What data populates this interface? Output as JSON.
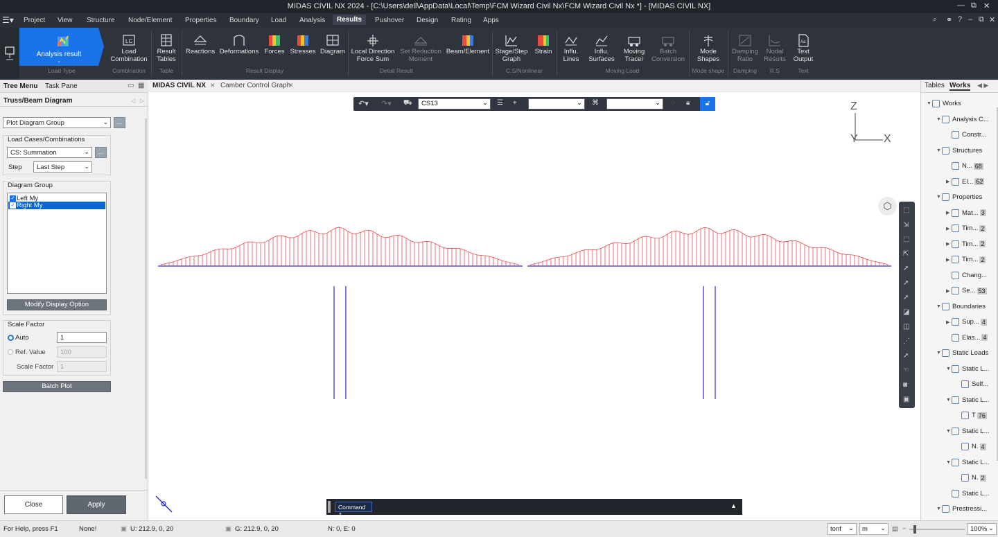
{
  "window": {
    "title": "MIDAS CIVIL NX 2024 - [C:\\Users\\dell\\AppData\\Local\\Temp\\FCM Wizard Civil Nx\\FCM Wizard Civil Nx *] - [MIDAS CIVIL NX]"
  },
  "menu": {
    "items": [
      "Project",
      "View",
      "Structure",
      "Node/Element",
      "Properties",
      "Boundary",
      "Load",
      "Analysis",
      "Results",
      "Pushover",
      "Design",
      "Rating",
      "Apps"
    ],
    "active": "Results"
  },
  "ribbon": {
    "analysis_result": "Analysis result",
    "buttons": {
      "load_combination": "Load\nCombination",
      "result_tables": "Result\nTables",
      "reactions": "Reactions",
      "deformations": "Deformations",
      "forces": "Forces",
      "stresses": "Stresses",
      "diagram": "Diagram",
      "local_direction": "Local Direction\nForce Sum",
      "set_reduction": "Set Reduction\nMoment",
      "beam_element": "Beam/Element",
      "stage_step_graph": "Stage/Step\nGraph",
      "strain": "Strain",
      "influ_lines": "Influ.\nLines",
      "influ_surfaces": "Influ.\nSurfaces",
      "moving_tracer": "Moving\nTracer",
      "batch_conversion": "Batch\nConversion",
      "mode_shapes": "Mode\nShapes",
      "damping_ratio": "Damping\nRatio",
      "nodal_results": "Nodal\nResults",
      "text_output": "Text\nOutput"
    },
    "groups": {
      "load_type": "Load Type",
      "combination": "Combination",
      "table": "Table",
      "result_display": "Result Display",
      "detail_result": "Detail Result",
      "cs_nonlinear": "C.S/Nonlinear",
      "moving_load": "Moving Load",
      "mode_shape": "Mode shape",
      "damping": "Damping",
      "rs": "R.S",
      "text": "Text"
    }
  },
  "left_panel": {
    "tabs": [
      "Tree Menu",
      "Task Pane"
    ],
    "title": "Truss/Beam Diagram",
    "plot_select": "Plot Diagram Group",
    "load_cases_label": "Load Cases/Combinations",
    "load_case_value": "CS: Summation",
    "step_label": "Step",
    "step_value": "Last Step",
    "diagram_group_label": "Diagram Group",
    "diagram_items": [
      "Left My",
      "Right My"
    ],
    "modify_button": "Modify Display Option",
    "scale_factor_label": "Scale Factor",
    "auto_label": "Auto",
    "auto_value": "1",
    "ref_value_label": "Ref. Value",
    "ref_value": "100",
    "scale_factor_field_label": "Scale Factor",
    "scale_factor_value": "1",
    "batch_plot": "Batch Plot",
    "close": "Close",
    "apply": "Apply"
  },
  "viewport": {
    "tabs": [
      "MIDAS CIVIL NX",
      "Camber Control Graph"
    ],
    "stage_select": "CS13",
    "axis_z": "Z",
    "axis_y": "Y",
    "axis_x": "X",
    "command_label": "Command"
  },
  "right_panel": {
    "tabs": [
      "Tables",
      "Works"
    ],
    "tree": [
      {
        "label": "Works",
        "level": 0,
        "toggle": "▼"
      },
      {
        "label": "Analysis C...",
        "level": 1,
        "toggle": "▼"
      },
      {
        "label": "Constr...",
        "level": 2,
        "toggle": ""
      },
      {
        "label": "Structures",
        "level": 1,
        "toggle": "▼"
      },
      {
        "label": "N...",
        "level": 2,
        "toggle": "",
        "count": "68"
      },
      {
        "label": "El...",
        "level": 2,
        "toggle": "▶",
        "count": "62"
      },
      {
        "label": "Properties",
        "level": 1,
        "toggle": "▼"
      },
      {
        "label": "Mat...",
        "level": 2,
        "toggle": "▶",
        "count": "3"
      },
      {
        "label": "Tim...",
        "level": 2,
        "toggle": "▶",
        "count": "2"
      },
      {
        "label": "Tim...",
        "level": 2,
        "toggle": "▶",
        "count": "2"
      },
      {
        "label": "Tim...",
        "level": 2,
        "toggle": "▶",
        "count": "2"
      },
      {
        "label": "Chang...",
        "level": 2,
        "toggle": ""
      },
      {
        "label": "Se...",
        "level": 2,
        "toggle": "▶",
        "count": "53"
      },
      {
        "label": "Boundaries",
        "level": 1,
        "toggle": "▼"
      },
      {
        "label": "Sup...",
        "level": 2,
        "toggle": "▶",
        "count": "4"
      },
      {
        "label": "Elas...",
        "level": 2,
        "toggle": "",
        "count": "4"
      },
      {
        "label": "Static Loads",
        "level": 1,
        "toggle": "▼"
      },
      {
        "label": "Static L...",
        "level": 2,
        "toggle": "▼"
      },
      {
        "label": "Self...",
        "level": 3,
        "toggle": ""
      },
      {
        "label": "Static L...",
        "level": 2,
        "toggle": "▼"
      },
      {
        "label": "T",
        "level": 3,
        "toggle": "",
        "count": "76"
      },
      {
        "label": "Static L...",
        "level": 2,
        "toggle": "▼"
      },
      {
        "label": "N.",
        "level": 3,
        "toggle": "",
        "count": "4"
      },
      {
        "label": "Static L...",
        "level": 2,
        "toggle": "▼"
      },
      {
        "label": "N.",
        "level": 3,
        "toggle": "",
        "count": "2"
      },
      {
        "label": "Static L...",
        "level": 2,
        "toggle": ""
      },
      {
        "label": "Prestressi...",
        "level": 1,
        "toggle": "▼"
      }
    ]
  },
  "status": {
    "help": "For Help, press F1",
    "selection": "None!",
    "u_coord": "U: 212.9, 0, 20",
    "g_coord": "G: 212.9, 0, 20",
    "ne": "N: 0, E: 0",
    "force_unit": "tonf",
    "length_unit": "m",
    "zoom": "100%"
  },
  "colors": {
    "accent": "#1a73e8",
    "diagram": "#e8323c",
    "member": "#2a2ad8"
  }
}
